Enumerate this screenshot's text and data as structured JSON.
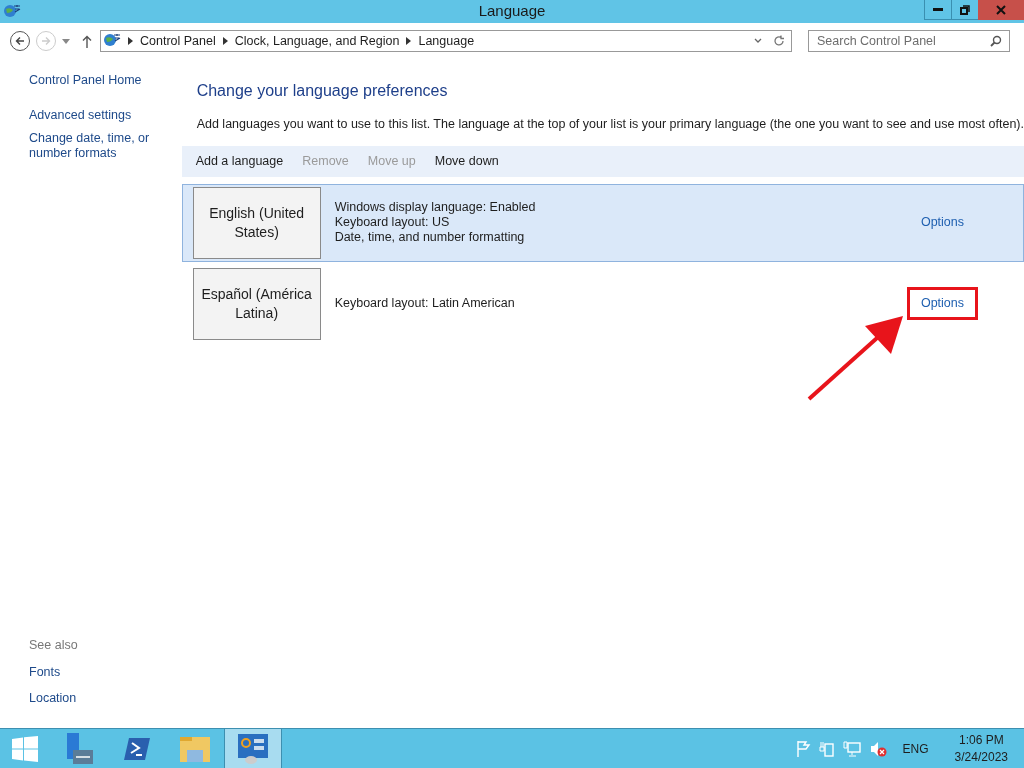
{
  "window": {
    "title": "Language"
  },
  "address_bar": {
    "crumbs": [
      "Control Panel",
      "Clock, Language, and Region",
      "Language"
    ]
  },
  "search": {
    "placeholder": "Search Control Panel"
  },
  "sidebar": {
    "items": [
      "Control Panel Home",
      "Advanced settings",
      "Change date, time, or number formats"
    ],
    "see_also": {
      "heading": "See also",
      "links": [
        "Fonts",
        "Location"
      ]
    }
  },
  "content": {
    "heading": "Change your language preferences",
    "description": "Add languages you want to use to this list. The language at the top of your list is your primary language (the one you want to see and use most often).",
    "toolbar": [
      {
        "label": "Add a language",
        "disabled": false
      },
      {
        "label": "Remove",
        "disabled": true
      },
      {
        "label": "Move up",
        "disabled": true
      },
      {
        "label": "Move down",
        "disabled": false
      }
    ],
    "languages": [
      {
        "name": "English (United States)",
        "details": [
          "Windows display language: Enabled",
          "Keyboard layout: US",
          "Date, time, and number formatting"
        ],
        "options": "Options",
        "selected": true,
        "highlighted": false
      },
      {
        "name": "Español (América Latina)",
        "details": [
          "Keyboard layout: Latin American"
        ],
        "options": "Options",
        "selected": false,
        "highlighted": true
      }
    ]
  },
  "taskbar": {
    "apps": [
      {
        "kind": "server",
        "selected": false
      },
      {
        "kind": "shell",
        "selected": false
      },
      {
        "kind": "folder",
        "selected": false
      },
      {
        "kind": "panel",
        "selected": true
      }
    ],
    "tray": {
      "language": "ENG",
      "time": "1:06 PM",
      "date": "3/24/2023"
    }
  }
}
